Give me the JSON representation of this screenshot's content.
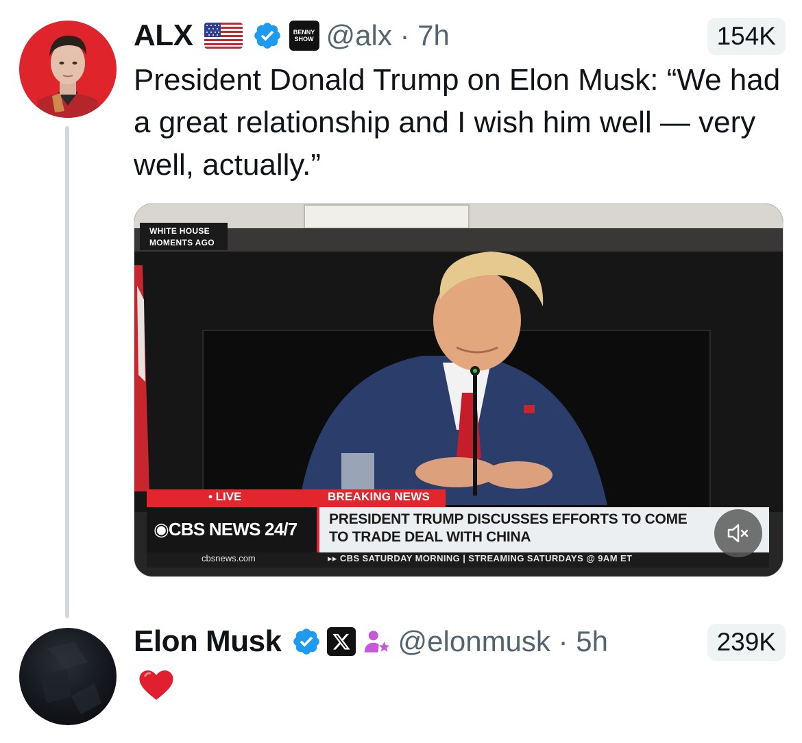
{
  "tweet1": {
    "author_name": "ALX",
    "badge_text": "BENNY SHOW",
    "handle_time": "@alx · 7h",
    "views": "154K",
    "text": "President Donald Trump on Elon Musk: “We had a great relationship and I wish him well — very well, actually.”",
    "video": {
      "location_tag": "WHITE HOUSE\nMOMENTS AGO",
      "live_label": "• LIVE",
      "breaking_label": "BREAKING NEWS",
      "network_label": "◉CBS NEWS 24/7",
      "headline": "PRESIDENT TRUMP DISCUSSES EFFORTS TO COME TO TRADE DEAL WITH CHINA",
      "url": "cbsnews.com",
      "ticker": "▸▸ CBS SATURDAY MORNING | STREAMING SATURDAYS @ 9AM ET",
      "mute_icon": "speaker-muted-icon"
    }
  },
  "tweet2": {
    "author_name": "Elon Musk",
    "handle_time": "@elonmusk · 5h",
    "views": "239K",
    "reply_icon": "red-heart-emoji"
  },
  "colors": {
    "accent_blue": "#1d9bf0",
    "cbs_red": "#e3262e",
    "muted_text": "#536471",
    "person_badge_purple": "#c659d8"
  }
}
